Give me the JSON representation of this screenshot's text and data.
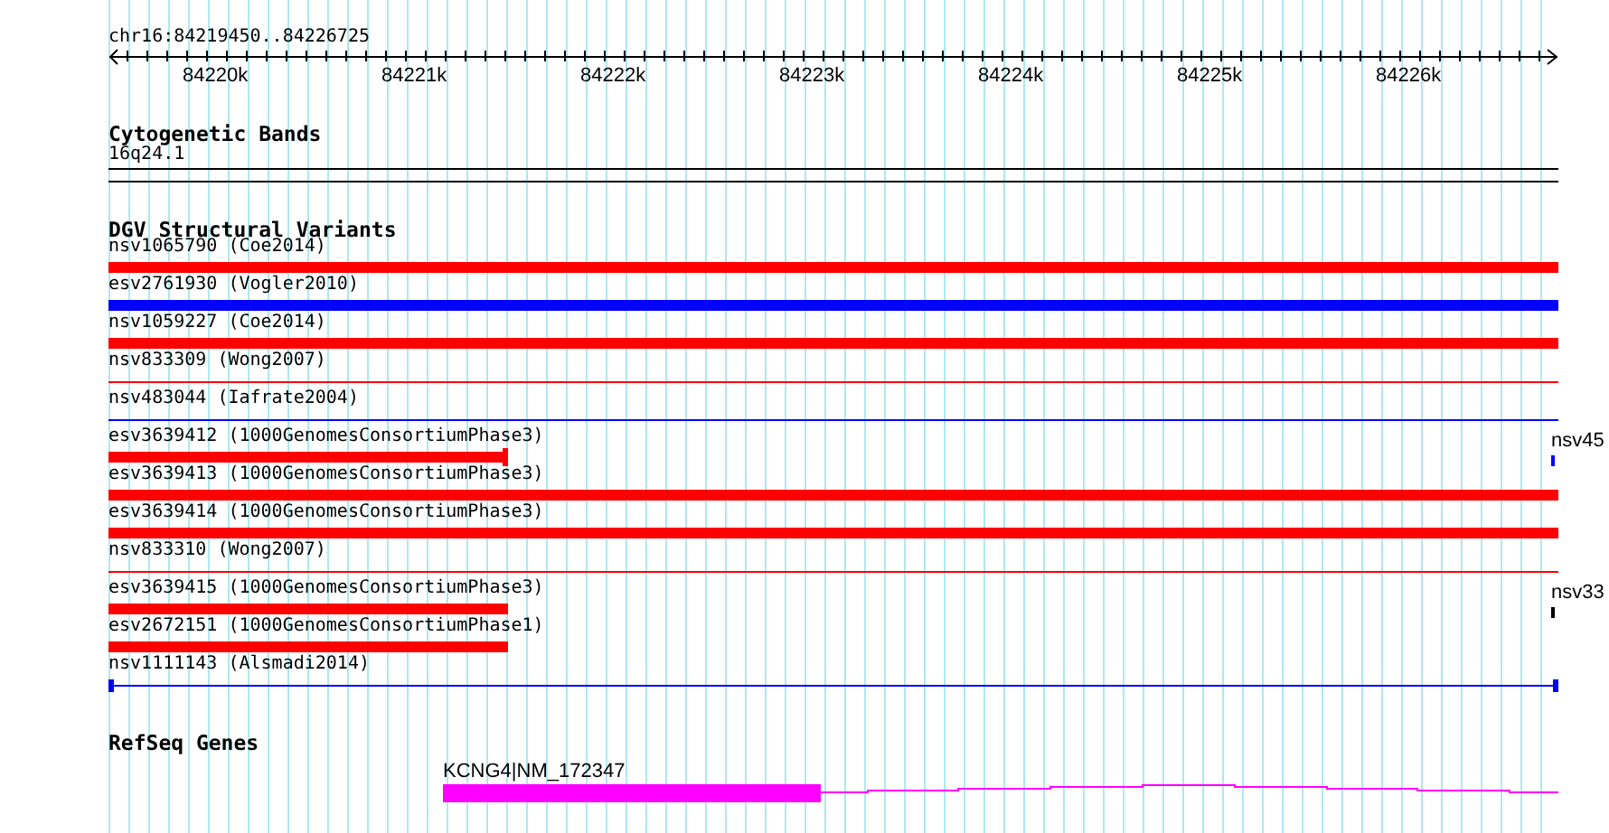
{
  "ruler": {
    "location": "chr16:84219450..84226725",
    "ticks": [
      "84220k",
      "84221k",
      "84222k",
      "84223k",
      "84224k",
      "84225k",
      "84226k"
    ]
  },
  "cytogenetic_bands": {
    "title": "Cytogenetic Bands",
    "band": "16q24.1"
  },
  "dgv_structural_variants": {
    "title": "DGV Structural Variants",
    "features": [
      {
        "label": "nsv1065790 (Coe2014)",
        "kind": "full-thick",
        "color": "#ff0000",
        "capped": false
      },
      {
        "label": "esv2761930 (Vogler2010)",
        "kind": "full-thick",
        "color": "#0000ff",
        "capped": false
      },
      {
        "label": "nsv1059227 (Coe2014)",
        "kind": "full-thick",
        "color": "#ff0000",
        "capped": false
      },
      {
        "label": "nsv833309 (Wong2007)",
        "kind": "full-thin",
        "color": "#ff0000",
        "capped": false
      },
      {
        "label": "nsv483044 (Iafrate2004)",
        "kind": "full-thin",
        "color": "#0000ff",
        "capped": false
      },
      {
        "label": "esv3639412 (1000GenomesConsortiumPhase3)",
        "kind": "partial-thick",
        "color": "#ff0000",
        "capped": true,
        "edge_feature": {
          "label": "nsv45",
          "color": "#0000ff"
        }
      },
      {
        "label": "esv3639413 (1000GenomesConsortiumPhase3)",
        "kind": "full-thick",
        "color": "#ff0000",
        "capped": false
      },
      {
        "label": "esv3639414 (1000GenomesConsortiumPhase3)",
        "kind": "full-thick",
        "color": "#ff0000",
        "capped": false
      },
      {
        "label": "nsv833310 (Wong2007)",
        "kind": "full-thin",
        "color": "#ff0000",
        "capped": false
      },
      {
        "label": "esv3639415 (1000GenomesConsortiumPhase3)",
        "kind": "partial-thick",
        "color": "#ff0000",
        "capped": false,
        "edge_feature": {
          "label": "nsv33",
          "color": "#000000"
        }
      },
      {
        "label": "esv2672151 (1000GenomesConsortiumPhase1)",
        "kind": "partial-thick",
        "color": "#ff0000",
        "capped": false
      },
      {
        "label": "nsv1111143 (Alsmadi2014)",
        "kind": "full-thin",
        "color": "#0000ff",
        "capped": true
      }
    ]
  },
  "refseq_genes": {
    "title": "RefSeq Genes",
    "gene": {
      "label": "KCNG4|NM_172347"
    }
  }
}
